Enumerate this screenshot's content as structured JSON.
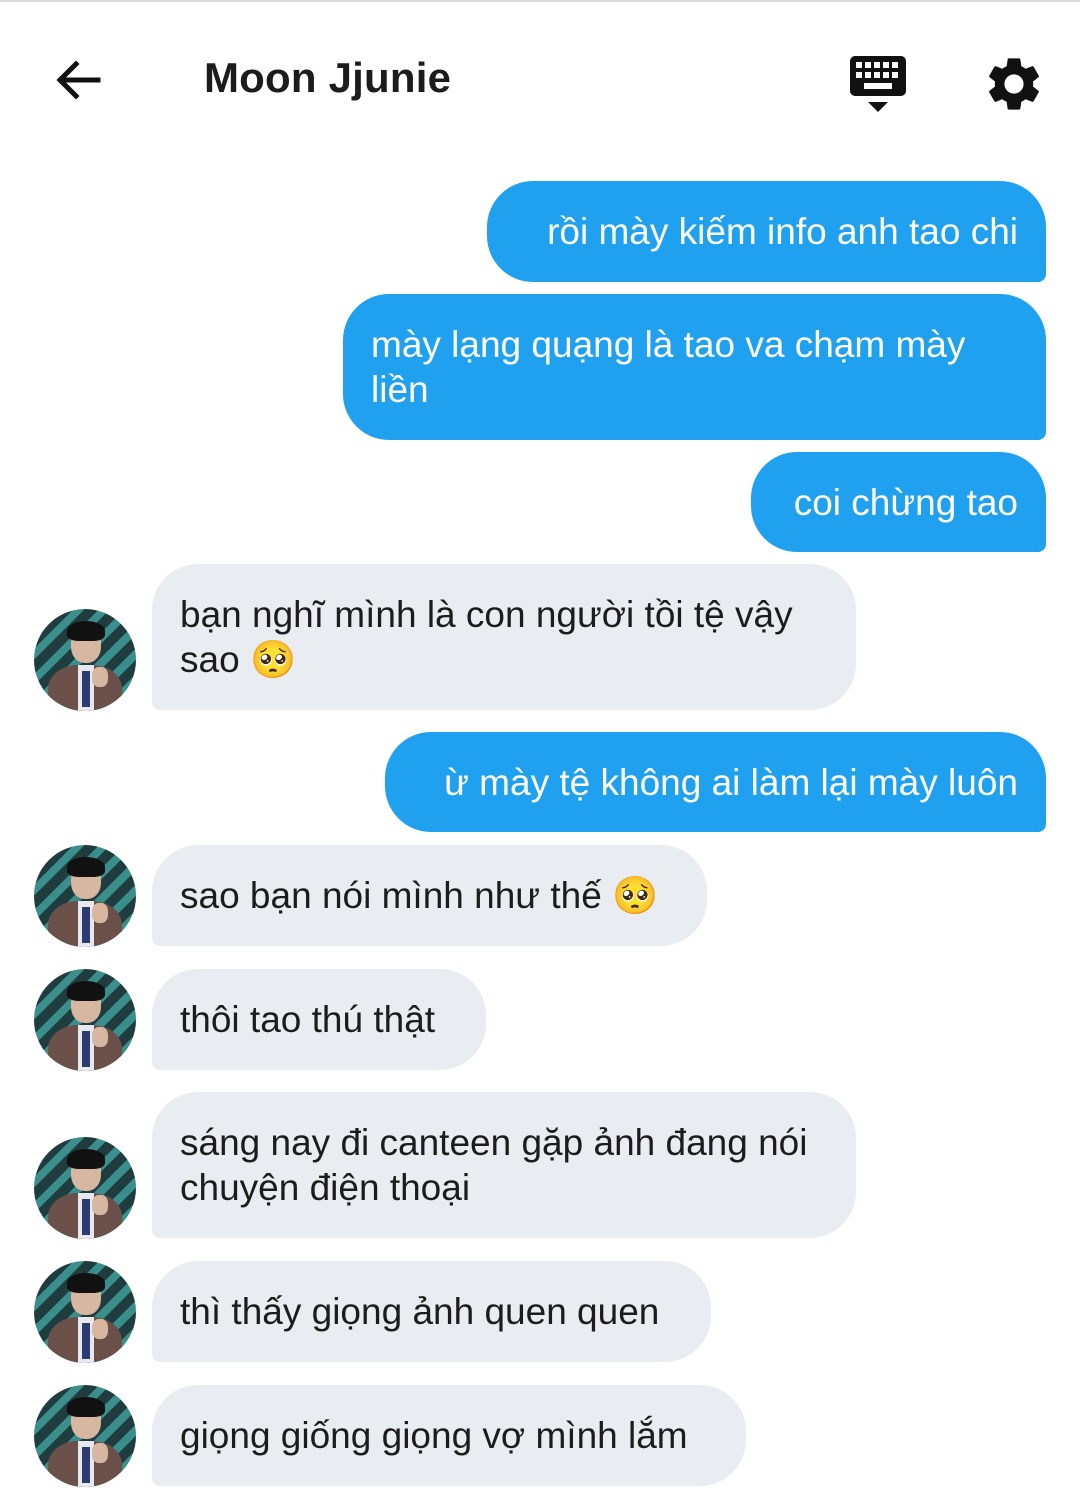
{
  "header": {
    "title": "Moon Jjunie"
  },
  "icons": {
    "back": "arrow-back-icon",
    "keyboard": "keyboard-hide-icon",
    "settings": "gear-icon",
    "emoji": "pleading-face-emoji"
  },
  "colors": {
    "outgoing_bubble": "#1fa1f0",
    "incoming_bubble": "#e9edf1",
    "text_dark": "#1c1c1c"
  },
  "messages": [
    {
      "direction": "out",
      "text": "rồi mày kiếm info anh tao chi"
    },
    {
      "direction": "out",
      "text": "mày lạng quạng là tao va chạm mày liền"
    },
    {
      "direction": "out",
      "text": "coi chừng tao"
    },
    {
      "direction": "in",
      "text": "bạn nghĩ mình là con người tồi tệ vậy sao",
      "emoji": "🥺"
    },
    {
      "direction": "out",
      "text": "ừ mày tệ không ai làm lại mày luôn"
    },
    {
      "direction": "in",
      "text": "sao bạn nói mình như thế",
      "emoji": "🥺"
    },
    {
      "direction": "in",
      "text": "thôi tao thú thật"
    },
    {
      "direction": "in",
      "text": "sáng nay đi canteen gặp ảnh đang nói chuyện điện thoại"
    },
    {
      "direction": "in",
      "text": "thì thấy giọng ảnh quen quen"
    },
    {
      "direction": "in",
      "text": "giọng giống giọng vợ mình lắm"
    }
  ]
}
